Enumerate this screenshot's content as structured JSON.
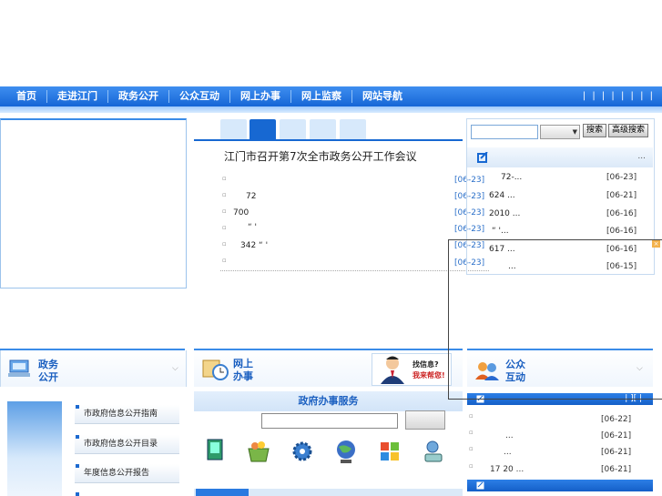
{
  "nav": {
    "items": [
      "首页",
      "走进江门",
      "政务公开",
      "公众互动",
      "网上办事",
      "网上监察",
      "网站导航"
    ],
    "right_text": "| | | | | |  |  |"
  },
  "news": {
    "headline": "江门市召开第7次全市政务公开工作会议",
    "dates": [
      "[06-23]",
      "[06-23]",
      "[06-23]",
      "[06-23]",
      "[06-23]",
      "[06-23]"
    ],
    "row_texts": [
      "",
      "72",
      "700",
      "“ '",
      "342      “ '",
      ""
    ]
  },
  "search": {
    "button": "搜索",
    "advanced_button": "高级搜索"
  },
  "right_list": {
    "more": "...",
    "rows": [
      {
        "text": "72-...",
        "date": "[06-23]"
      },
      {
        "text": "624     ...",
        "date": "[06-21]"
      },
      {
        "text": "2010       ...",
        "date": "[06-16]"
      },
      {
        "text": "“    '...",
        "date": "[06-16]"
      },
      {
        "text": "617     ...",
        "date": "[06-16]"
      },
      {
        "text": "...",
        "date": "[06-15]"
      }
    ]
  },
  "popup": {
    "close": "×"
  },
  "zhengwu": {
    "title_line1": "政务",
    "title_line2": "公开",
    "docs": [
      "市政府信息公开指南",
      "市政府信息公开目录",
      "年度信息公开报告"
    ]
  },
  "banshi": {
    "title_line1": "网上",
    "title_line2": "办事",
    "ad_line1": "找信息?",
    "ad_line2": "我来帮您!",
    "service_title": "政府办事服务"
  },
  "hudong": {
    "title_line1": "公众",
    "title_line2": "互动",
    "bar_links": "| ][ |",
    "rows": [
      {
        "text": "",
        "date": "[06-22]"
      },
      {
        "text": "...",
        "date": "[06-21]"
      },
      {
        "text": "...",
        "date": "[06-21]"
      },
      {
        "text": "17 20   ...",
        "date": "[06-21]"
      }
    ]
  },
  "colors": {
    "nav": "#1768d2",
    "accent": "#3a8be8",
    "date_blue": "#2a6fc9"
  }
}
